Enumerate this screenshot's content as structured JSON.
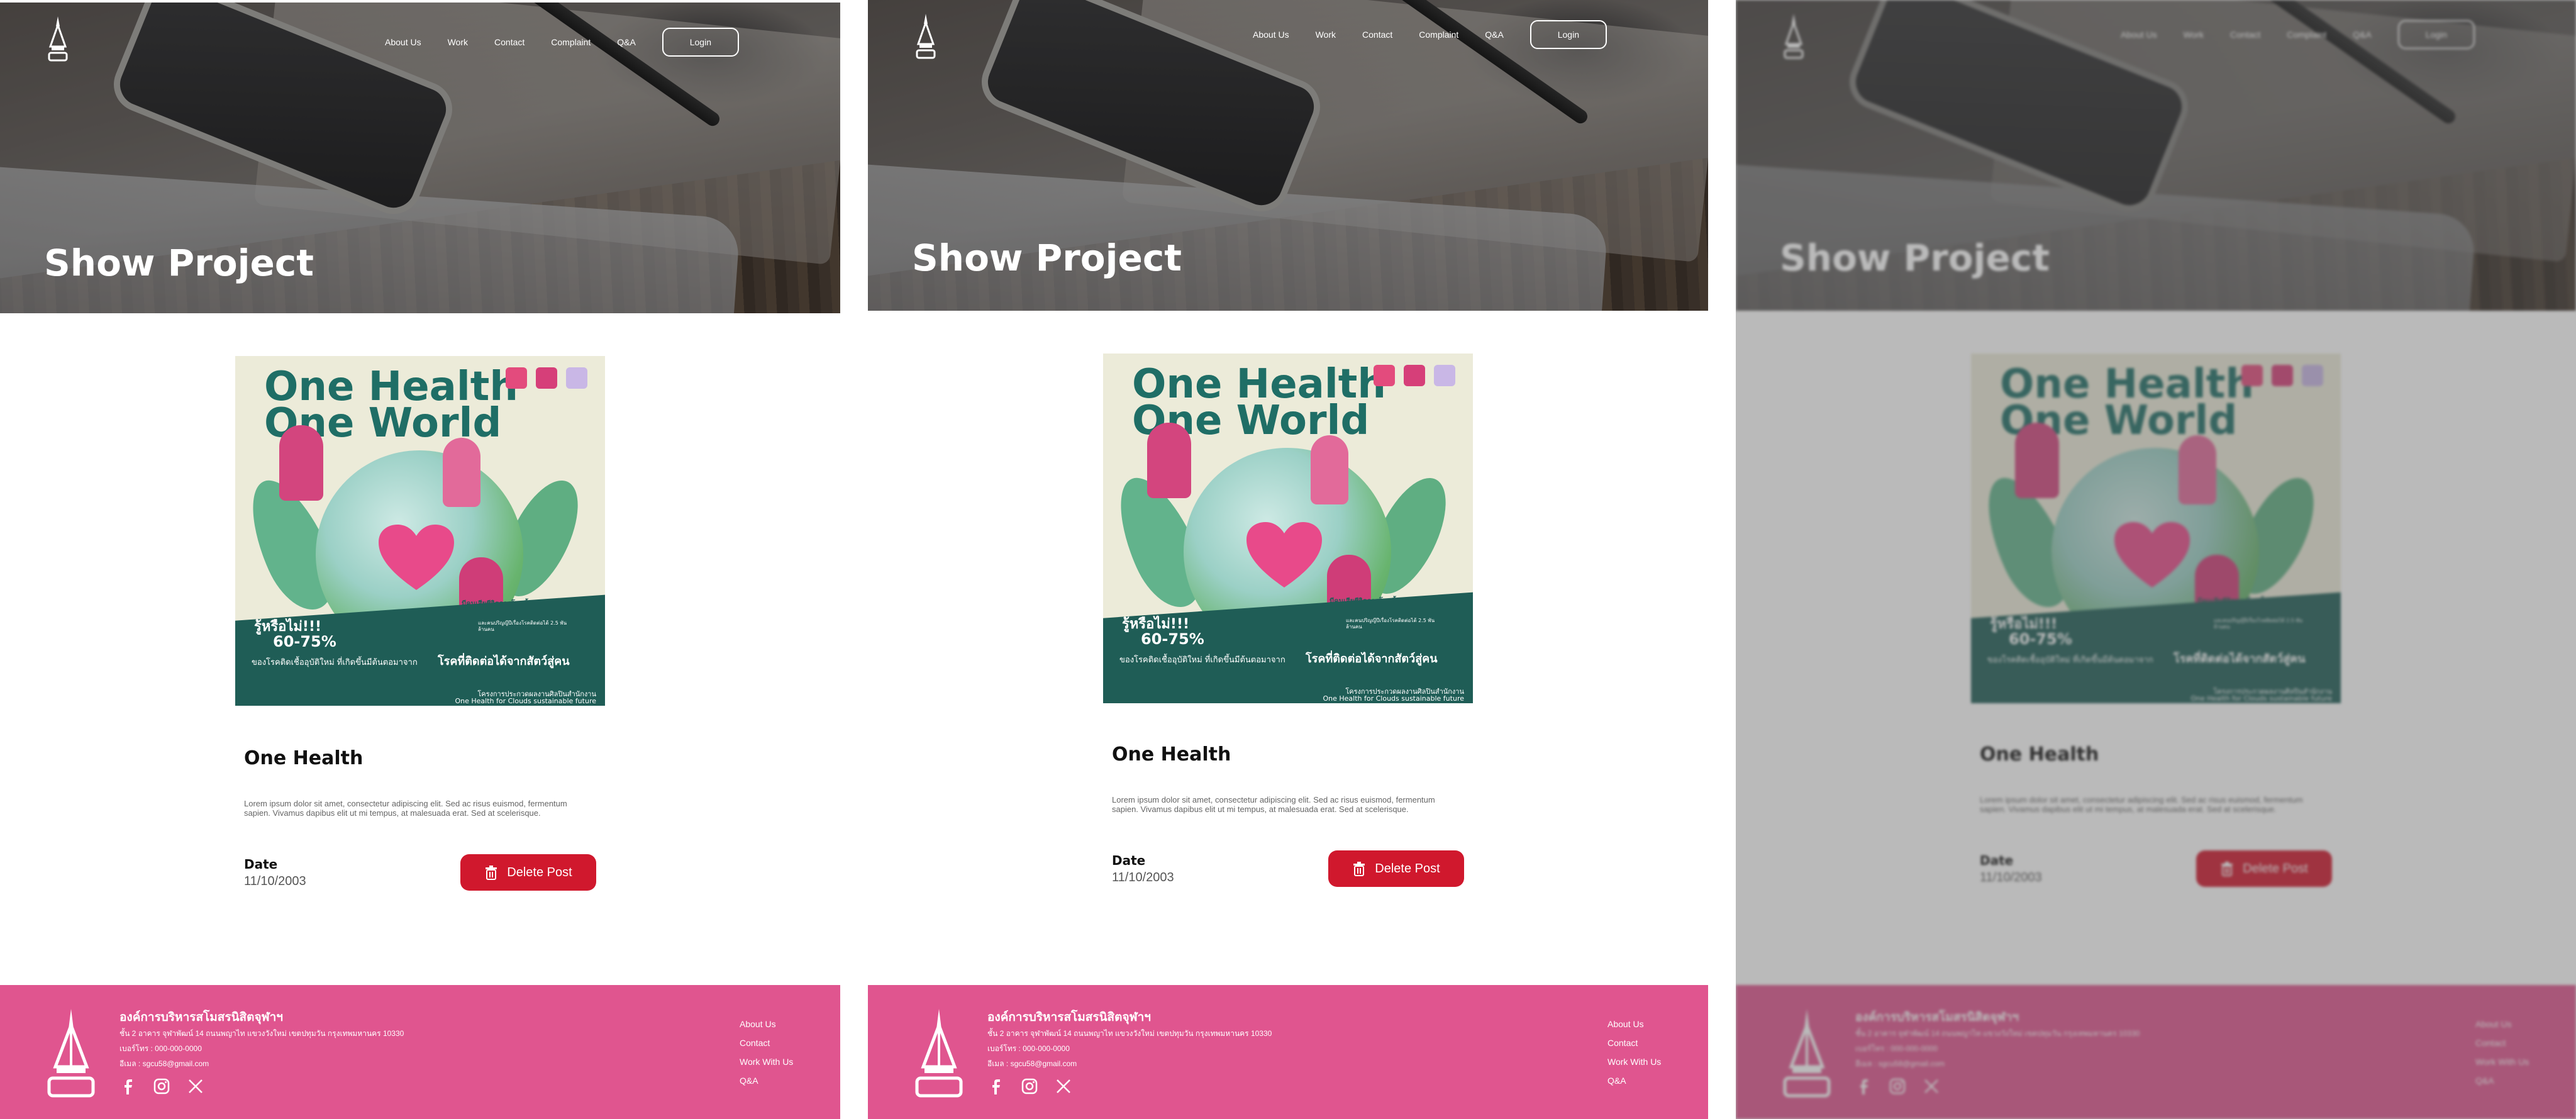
{
  "nav": {
    "items": [
      "About Us",
      "Work",
      "Contact",
      "Complaint",
      "Q&A"
    ],
    "login_label": "Login"
  },
  "hero": {
    "title": "Show Project"
  },
  "poster": {
    "title_line1": "One Health",
    "title_line2": "One World",
    "band_heading": "รู้หรือไม่!!!",
    "band_percent": "60-75%",
    "band_left_text": "ของโรคติดเชื้ออุบัติใหม่ ที่เกิดขึ้นมีต้นตอมาจาก",
    "band_right_text": "โรคที่ติดต่อได้จากสัตว์สู่คน",
    "top_note": "มีคนเสียชีวิตจากโรคนี้ 8.7 ล้านคน",
    "small_note": "และคนปริญญีปีเรื่องโรคติดต่อได้ 2.5 พันล้านคน",
    "footer_line1": "โครงการประกวดผลงานศิลปินสำนักงาน",
    "footer_line2": "One Health for Clouds sustainable future"
  },
  "post": {
    "title": "One Health",
    "body": "Lorem ipsum dolor sit amet, consectetur adipiscing elit. Sed ac risus euismod, fermentum sapien. Vivamus dapibus elit ut mi tempus, at malesuada erat. Sed at scelerisque.",
    "date_label": "Date",
    "date_value": "11/10/2003",
    "delete_label": "Delete Post"
  },
  "footer": {
    "org_name": "องค์การบริหารสโมสรนิสิตจุฬาฯ",
    "address": "ชั้น 2 อาคาร จุฬาพัฒน์ 14 ถนนพญาไท แขวงวังใหม่ เขตปทุมวัน กรุงเทพมหานคร 10330",
    "phone": "เบอร์โทร : 000-000-0000",
    "email": "อีเมล : sgcu58@gmail.com",
    "links": [
      "About Us",
      "Contact",
      "Work With Us",
      "Q&A"
    ],
    "social_icons": [
      "facebook-icon",
      "instagram-icon",
      "x-icon"
    ]
  },
  "colors": {
    "footer_pink": "#e0558f",
    "delete_red": "#d0182d",
    "poster_green": "#1f5d56"
  }
}
